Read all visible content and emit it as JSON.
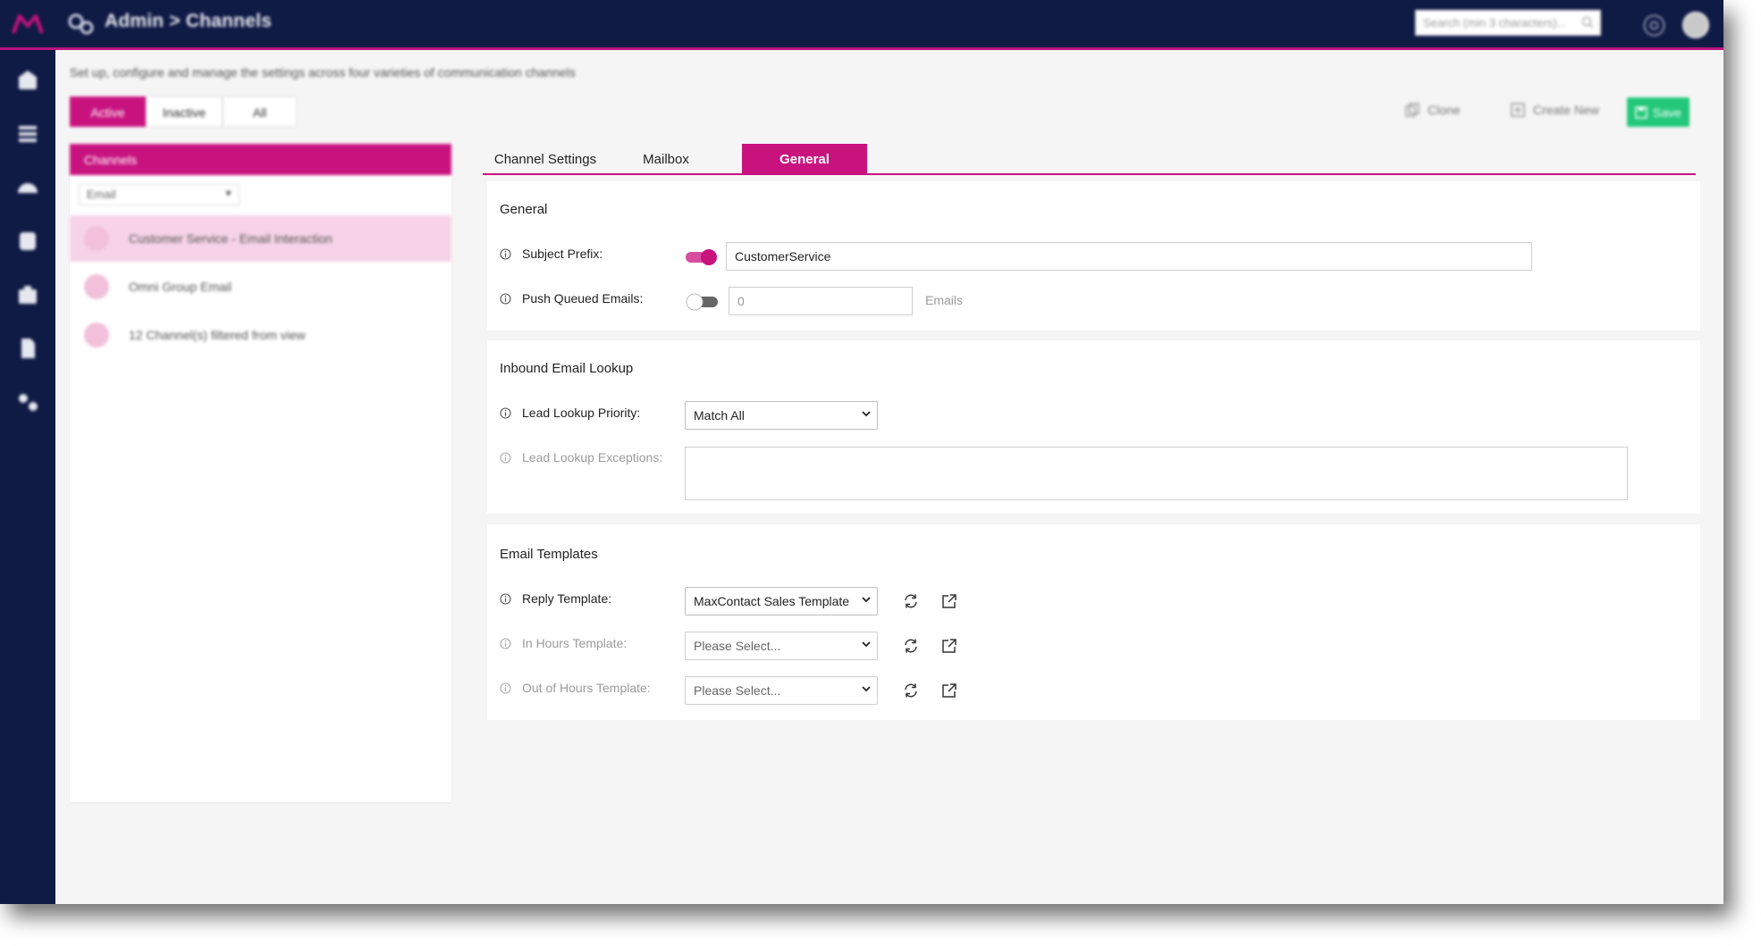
{
  "topbar": {
    "breadcrumb": "Admin > Channels",
    "search_placeholder": "Search (min 3 characters)..."
  },
  "page": {
    "subtitle": "Set up, configure and manage the settings across four varieties of communication channels",
    "filters": [
      {
        "label": "Active",
        "active": true
      },
      {
        "label": "Inactive",
        "active": false
      },
      {
        "label": "All",
        "active": false
      }
    ],
    "actions": {
      "clone": "Clone",
      "create_new": "Create New",
      "save": "Save"
    }
  },
  "channels_panel": {
    "header": "Channels",
    "type_select": "Email",
    "items": [
      {
        "label": "Customer Service - Email Interaction",
        "selected": true
      },
      {
        "label": "Omni Group Email",
        "selected": false
      },
      {
        "label": "12 Channel(s) filtered from view",
        "selected": false
      }
    ]
  },
  "tabs": [
    {
      "label": "Channel Settings",
      "active": false
    },
    {
      "label": "Mailbox",
      "active": false
    },
    {
      "label": "General",
      "active": true
    }
  ],
  "general": {
    "title": "General",
    "subject_prefix": {
      "label": "Subject Prefix:",
      "enabled": true,
      "value": "CustomerService"
    },
    "push_queued": {
      "label": "Push Queued Emails:",
      "enabled": false,
      "value": "0",
      "unit": "Emails"
    }
  },
  "inbound": {
    "title": "Inbound Email Lookup",
    "lead_lookup_priority": {
      "label": "Lead Lookup Priority:",
      "value": "Match All"
    },
    "lead_lookup_exceptions": {
      "label": "Lead Lookup Exceptions:",
      "value": ""
    }
  },
  "templates": {
    "title": "Email Templates",
    "reply": {
      "label": "Reply Template:",
      "value": "MaxContact Sales Template"
    },
    "in_hours": {
      "label": "In Hours Template:",
      "value": "Please Select..."
    },
    "out_of_hours": {
      "label": "Out of Hours Template:",
      "value": "Please Select..."
    }
  },
  "colors": {
    "nav": "#0f1a45",
    "accent": "#c8137f",
    "save": "#22c77a",
    "selected_row": "#f6d3e7"
  }
}
